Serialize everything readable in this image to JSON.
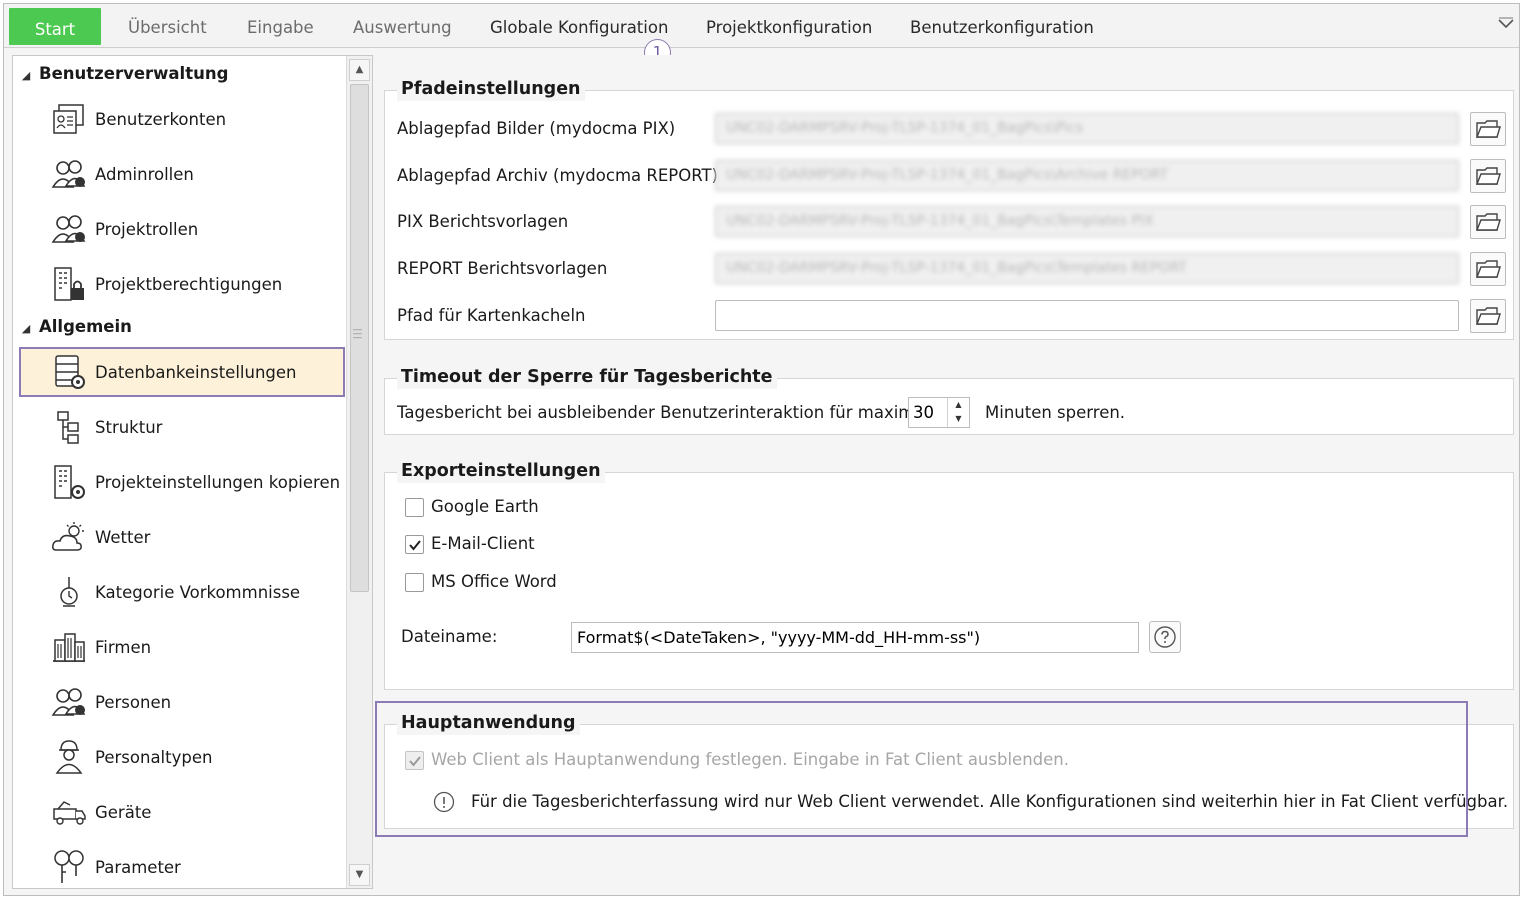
{
  "tabs": [
    {
      "label": "Start"
    },
    {
      "label": "Übersicht"
    },
    {
      "label": "Eingabe"
    },
    {
      "label": "Auswertung"
    },
    {
      "label": "Globale Konfiguration"
    },
    {
      "label": "Projektkonfiguration"
    },
    {
      "label": "Benutzerkonfiguration"
    }
  ],
  "callout": {
    "number": "1"
  },
  "nav": {
    "groups": [
      {
        "label": "Benutzerverwaltung"
      },
      {
        "label": "Allgemein"
      }
    ],
    "items": [
      {
        "label": "Benutzerkonten",
        "icon": "user-accounts-icon"
      },
      {
        "label": "Adminrollen",
        "icon": "admin-roles-icon"
      },
      {
        "label": "Projektrollen",
        "icon": "project-roles-icon"
      },
      {
        "label": "Projektberechtigungen",
        "icon": "project-permissions-icon"
      },
      {
        "label": "Datenbankeinstellungen",
        "icon": "database-settings-icon",
        "selected": true
      },
      {
        "label": "Struktur",
        "icon": "structure-icon"
      },
      {
        "label": "Projekteinstellungen kopieren",
        "icon": "copy-project-settings-icon"
      },
      {
        "label": "Wetter",
        "icon": "weather-icon"
      },
      {
        "label": "Kategorie Vorkommnisse",
        "icon": "incident-category-icon"
      },
      {
        "label": "Firmen",
        "icon": "companies-icon"
      },
      {
        "label": "Personen",
        "icon": "persons-icon"
      },
      {
        "label": "Personaltypen",
        "icon": "staff-types-icon"
      },
      {
        "label": "Geräte",
        "icon": "equipment-icon"
      },
      {
        "label": "Parameter",
        "icon": "parameter-icon"
      }
    ]
  },
  "paths": {
    "title": "Pfadeinstellungen",
    "rows": [
      {
        "label": "Ablagepfad Bilder (mydocma PIX)",
        "value": "UNC02-DARMPSRV-Proj-TLSP-1374_01_BagPics\\Pics"
      },
      {
        "label": "Ablagepfad Archiv (mydocma REPORT)",
        "value": "UNC02-DARMPSRV-Proj-TLSP-1374_01_BagPics\\Archive REPORT"
      },
      {
        "label": "PIX Berichtsvorlagen",
        "value": "UNC02-DARMPSRV-Proj-TLSP-1374_01_BagPics\\Templates PIX"
      },
      {
        "label": "REPORT Berichtsvorlagen",
        "value": "UNC02-DARMPSRV-Proj-TLSP-1374_01_BagPics\\Templates REPORT"
      },
      {
        "label": "Pfad für Kartenkacheln",
        "value": ""
      }
    ]
  },
  "timeout": {
    "title": "Timeout der Sperre für Tagesberichte",
    "label_before": "Tagesbericht bei ausbleibender Benutzerinteraktion für maximal",
    "value": "30",
    "label_after": "Minuten sperren."
  },
  "export": {
    "title": "Exporteinstellungen",
    "options": [
      {
        "label": "Google Earth",
        "checked": false
      },
      {
        "label": "E-Mail-Client",
        "checked": true
      },
      {
        "label": "MS Office Word",
        "checked": false
      }
    ],
    "filename_label": "Dateiname:",
    "filename_value": "Format$(<DateTaken>, \"yyyy-MM-dd_HH-mm-ss\")"
  },
  "main_app": {
    "title": "Hauptanwendung",
    "checkbox_label": "Web Client als Hauptanwendung festlegen. Eingabe in Fat Client ausblenden.",
    "checked": true,
    "info_text": "Für die Tagesberichterfassung wird nur Web Client verwendet. Alle Konfigurationen sind weiterhin hier in Fat Client verfügbar."
  },
  "colors": {
    "start_tab": "#4cc950",
    "selection_bg": "#fdf1da",
    "highlight_border": "#8d7bb5"
  }
}
